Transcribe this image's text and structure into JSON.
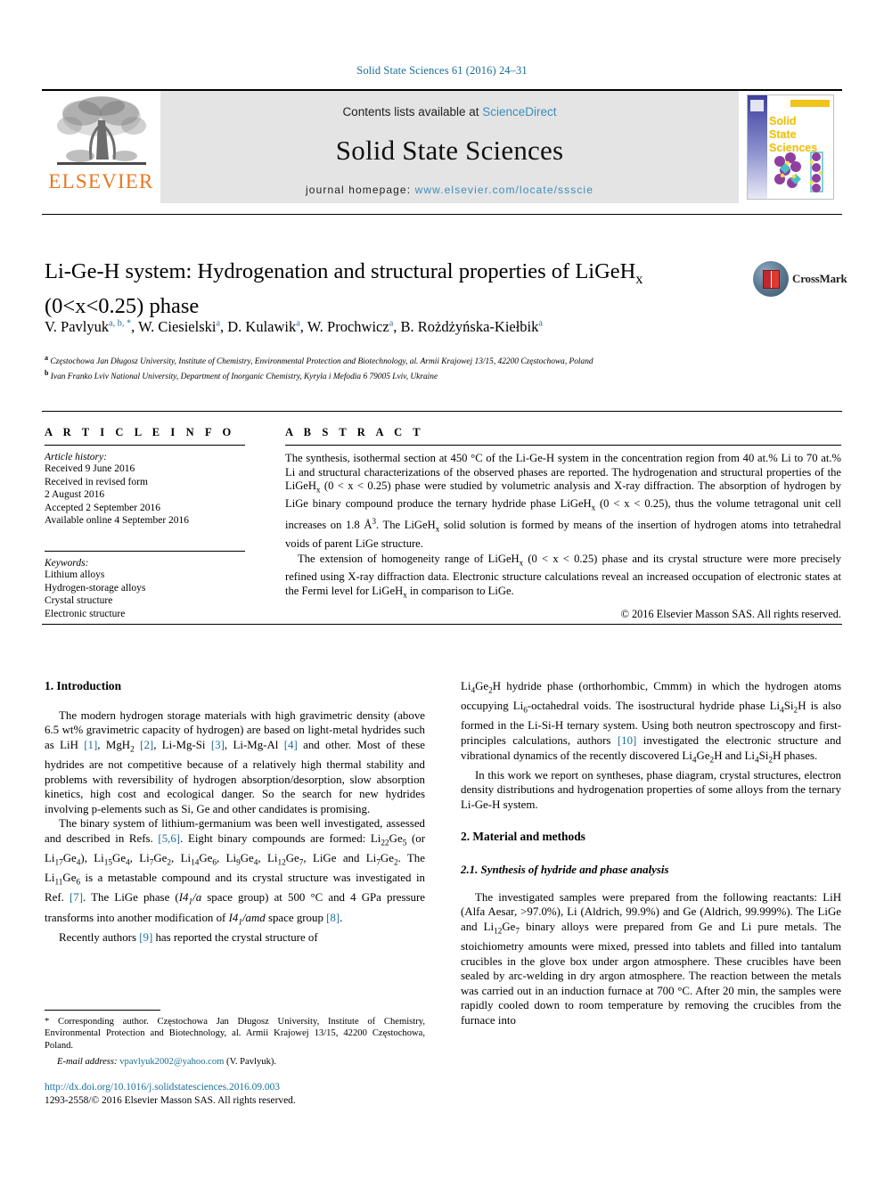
{
  "running_head": "Solid State Sciences 61 (2016) 24–31",
  "masthead": {
    "publisher_name": "ELSEVIER",
    "contents_prefix": "Contents lists available at ",
    "contents_link": "ScienceDirect",
    "journal_title": "Solid State Sciences",
    "homepage_label": "journal homepage: ",
    "homepage_url": "www.elsevier.com/locate/ssscie",
    "cover_title_lines": [
      "Solid",
      "State",
      "Sciences"
    ]
  },
  "article": {
    "title_line1_pre": "Li-Ge-H system: Hydrogenation and structural properties of LiGeH",
    "title_sub": "x",
    "title_line2": "(0<x<0.25) phase",
    "crossmark_label": "CrossMark",
    "authors": [
      {
        "name": "V. Pavlyuk",
        "marks": "a, b, *"
      },
      {
        "name": "W. Ciesielski",
        "marks": "a"
      },
      {
        "name": "D. Kulawik",
        "marks": "a"
      },
      {
        "name": "W. Prochwicz",
        "marks": "a"
      },
      {
        "name": "B. Rożdżyńska-Kiełbik",
        "marks": "a"
      }
    ],
    "affiliations": [
      {
        "mark": "a",
        "text": "Częstochowa Jan Długosz University, Institute of Chemistry, Environmental Protection and Biotechnology, al. Armii Krajowej 13/15, 42200 Częstochowa, Poland"
      },
      {
        "mark": "b",
        "text": "Ivan Franko Lviv National University, Department of Inorganic Chemistry, Kyryla i Mefodia 6 79005 Lviv, Ukraine"
      }
    ]
  },
  "article_info": {
    "heading": "A R T I C L E  I N F O",
    "history_label": "Article history:",
    "history": [
      "Received 9 June 2016",
      "Received in revised form",
      "2 August 2016",
      "Accepted 2 September 2016",
      "Available online 4 September 2016"
    ],
    "keywords_label": "Keywords:",
    "keywords": [
      "Lithium alloys",
      "Hydrogen-storage alloys",
      "Crystal structure",
      "Electronic structure"
    ]
  },
  "abstract": {
    "heading": "A B S T R A C T",
    "para1_a": "The synthesis, isothermal section at 450 °C of the Li-Ge-H system in the concentration region from 40 at.% Li to 70 at.% Li and structural characterizations of the observed phases are reported. The hydrogenation and structural properties of the LiGeH",
    "para1_b": " (0 < x < 0.25) phase were studied by volumetric analysis and X-ray diffraction. The absorption of hydrogen by LiGe binary compound produce the ternary hydride phase LiGeH",
    "para1_c": " (0 < x < 0.25), thus the volume tetragonal unit cell increases on 1.8 Å",
    "para1_d": ". The LiGeH",
    "para1_e": " solid solution is formed by means of the insertion of hydrogen atoms into tetrahedral voids of parent LiGe structure.",
    "para2_a": "The extension of homogeneity range of LiGeH",
    "para2_b": " (0 < x < 0.25) phase and its crystal structure were more precisely refined using X-ray diffraction data. Electronic structure calculations reveal an increased occupation of electronic states at the Fermi level for LiGeH",
    "para2_c": " in comparison to LiGe.",
    "copyright": "© 2016 Elsevier Masson SAS. All rights reserved."
  },
  "body": {
    "intro_heading": "1. Introduction",
    "intro_p1_a": "The modern hydrogen storage materials with high gravimetric density (above 6.5 wt% gravimetric capacity of hydrogen) are based on light-metal hydrides such as LiH ",
    "intro_p1_r1": "[1]",
    "intro_p1_b": ", MgH",
    "intro_p1_sub1": "2",
    "intro_p1_c": " ",
    "intro_p1_r2": "[2]",
    "intro_p1_d": ", Li-Mg-Si ",
    "intro_p1_r3": "[3]",
    "intro_p1_e": ", Li-Mg-Al ",
    "intro_p1_r4": "[4]",
    "intro_p1_f": " and other. Most of these hydrides are not competitive because of a relatively high thermal stability and problems with reversibility of hydrogen absorption/desorption, slow absorption kinetics, high cost and ecological danger. So the search for new hydrides involving p-elements such as Si, Ge and other candidates is promising.",
    "intro_p2_a": "The binary system of lithium-germanium was been well investigated, assessed and described in Refs. ",
    "intro_p2_r1": "[5,6]",
    "intro_p2_b": ". Eight binary compounds are formed: Li",
    "intro_p2_c": "Ge",
    "intro_p2_d": " (or Li",
    "intro_p2_e": "Ge",
    "intro_p2_f": "), Li",
    "intro_p2_g": "Ge",
    "intro_p2_h": ", Li",
    "intro_p2_tail": ", LiGe and Li",
    "intro_p2_meta_a": ". The Li",
    "intro_p2_meta_b": "Ge",
    "intro_p2_meta_c": " is a metastable compound and its crystal structure was investigated in Ref. ",
    "intro_p2_r2": "[7]",
    "intro_p2_meta_d": ". The LiGe phase (",
    "intro_p2_sg1": "I4",
    "intro_p2_sg1sub": "1",
    "intro_p2_sg1b": "/a",
    "intro_p2_meta_e": " space group) at 500 °C and 4 GPa pressure transforms into another modification of ",
    "intro_p2_sg2": "I4",
    "intro_p2_sg2sub": "1",
    "intro_p2_sg2b": "/amd",
    "intro_p2_meta_f": " space group ",
    "intro_p2_r3": "[8]",
    "intro_p2_meta_g": ".",
    "intro_p3_a": "Recently authors ",
    "intro_p3_r1": "[9]",
    "intro_p3_b": " has reported the crystal structure of",
    "right_p1_a": "Li",
    "right_p1_b": "Ge",
    "right_p1_c": "H hydride phase (orthorhombic, Cmmm) in which the hydrogen atoms occupying Li",
    "right_p1_sub6": "6",
    "right_p1_d": "-octahedral voids. The isostructural hydride phase Li",
    "right_p1_e": "Si",
    "right_p1_f": "H is also formed in the Li-Si-H ternary system. Using both neutron spectroscopy and first-principles calculations, authors ",
    "right_p1_r1": "[10]",
    "right_p1_g": " investigated the electronic structure and vibrational dynamics of the recently discovered Li",
    "right_p1_h": "Ge",
    "right_p1_i": "H and Li",
    "right_p1_j": "Si",
    "right_p1_k": "H phases.",
    "right_p2": "In this work we report on syntheses, phase diagram, crystal structures, electron density distributions and hydrogenation properties of some alloys from the ternary Li-Ge-H system.",
    "methods_heading": "2. Material and methods",
    "methods_sub_heading": "2.1. Synthesis of hydride and phase analysis",
    "methods_p1_a": "The investigated samples were prepared from the following reactants: LiH (Alfa Aesar, >97.0%), Li (Aldrich, 99.9%) and Ge (Aldrich, 99.999%). The LiGe and Li",
    "methods_p1_sub12": "12",
    "methods_p1_b": "Ge",
    "methods_p1_sub7": "7",
    "methods_p1_c": " binary alloys were prepared from Ge and Li pure metals. The stoichiometry amounts were mixed, pressed into tablets and filled into tantalum crucibles in the glove box under argon atmosphere. These crucibles have been sealed by arc-welding in dry argon atmosphere. The reaction between the metals was carried out in an induction furnace at 700 °C. After 20 min, the samples were rapidly cooled down to room temperature by removing the crucibles from the furnace into"
  },
  "footnote": {
    "corresponding": "* Corresponding author. Częstochowa Jan Długosz University, Institute of Chemistry, Environmental Protection and Biotechnology, al. Armii Krajowej 13/15, 42200 Częstochowa, Poland.",
    "email_label": "E-mail address: ",
    "email_link": "vpavlyuk2002@yahoo.com",
    "email_suffix": " (V. Pavlyuk)."
  },
  "bottom_meta": {
    "doi": "http://dx.doi.org/10.1016/j.solidstatesciences.2016.09.003",
    "issn_line": "1293-2558/© 2016 Elsevier Masson SAS. All rights reserved."
  },
  "colors": {
    "link_blue": "#1a6d96",
    "sciencedirect_blue": "#3c8dbc",
    "elsevier_orange": "#e87722",
    "banner_grey": "#e4e4e4"
  }
}
